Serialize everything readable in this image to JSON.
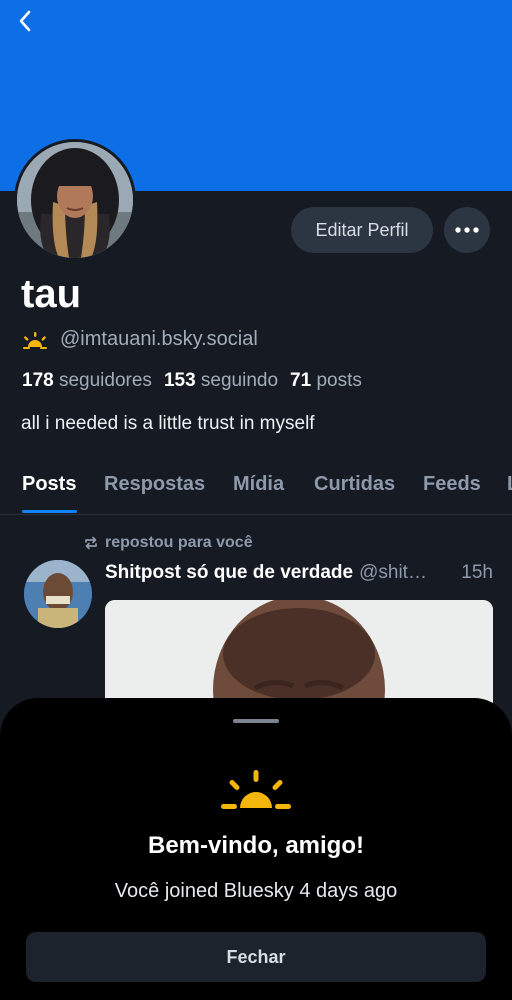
{
  "profile": {
    "display_name": "tau",
    "handle": "@imtauani.bsky.social",
    "handle_icon": "sunrise-icon",
    "followers_count": "178",
    "followers_label": "seguidores",
    "following_count": "153",
    "following_label": "seguindo",
    "posts_count": "71",
    "posts_label": "posts",
    "bio": "all i needed is a little trust in myself"
  },
  "header": {
    "edit_label": "Editar Perfil",
    "more_icon": "more-horizontal-icon",
    "back_icon": "chevron-left-icon",
    "banner_color": "#0d6fe6"
  },
  "tabs": [
    {
      "label": "Posts",
      "active": true
    },
    {
      "label": "Respostas",
      "active": false
    },
    {
      "label": "Mídia",
      "active": false
    },
    {
      "label": "Curtidas",
      "active": false
    },
    {
      "label": "Feeds",
      "active": false
    }
  ],
  "feed": {
    "repost_label": "repostou para você",
    "post": {
      "author": "Shitpost só que de verdade",
      "handle": "@shit…",
      "time": "15h"
    }
  },
  "sheet": {
    "title": "Bem-vindo, amigo!",
    "text": "Você joined Bluesky 4 days ago",
    "close_label": "Fechar",
    "icon": "sunrise-icon",
    "icon_color": "#f5b60b"
  },
  "colors": {
    "background": "#151a23",
    "accent": "#1083fe",
    "sheet_bg": "#000000"
  }
}
